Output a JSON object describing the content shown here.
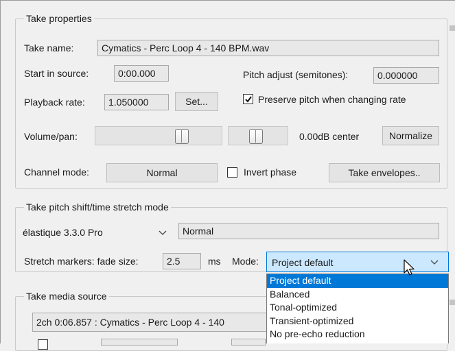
{
  "take_properties": {
    "legend": "Take properties",
    "take_name_label": "Take name:",
    "take_name_value": "Cymatics - Perc Loop 4 - 140 BPM.wav",
    "start_label": "Start in source:",
    "start_value": "0:00.000",
    "pitch_label": "Pitch adjust (semitones):",
    "pitch_value": "0.000000",
    "rate_label": "Playback rate:",
    "rate_value": "1.050000",
    "set_button": "Set...",
    "preserve_pitch_label": "Preserve pitch when changing rate",
    "preserve_pitch_checked": true,
    "volpan_label": "Volume/pan:",
    "volume_level": 0.5,
    "pan_level": 0.5,
    "volpan_readout": "0.00dB center",
    "normalize_button": "Normalize",
    "channel_mode_label": "Channel mode:",
    "channel_mode_value": "Normal",
    "invert_phase_label": "Invert phase",
    "invert_phase_checked": false,
    "take_envelopes_button": "Take envelopes.."
  },
  "pitch_shift": {
    "legend": "Take pitch shift/time stretch mode",
    "algorithm": "élastique 3.3.0 Pro",
    "submode": "Normal",
    "fade_label": "Stretch markers: fade size:",
    "fade_value": "2.5",
    "fade_unit": "ms",
    "mode_label": "Mode:",
    "mode_value": "Project default",
    "mode_options": [
      "Project default",
      "Balanced",
      "Tonal-optimized",
      "Transient-optimized",
      "No pre-echo reduction"
    ]
  },
  "media_source": {
    "legend": "Take media source",
    "source_text": "2ch 0:06.857 : Cymatics - Perc Loop 4 - 140"
  },
  "colors": {
    "selection": "#0078d7",
    "dropdown_highlight": "#cce8ff",
    "field_bg": "#e8e8e8"
  }
}
